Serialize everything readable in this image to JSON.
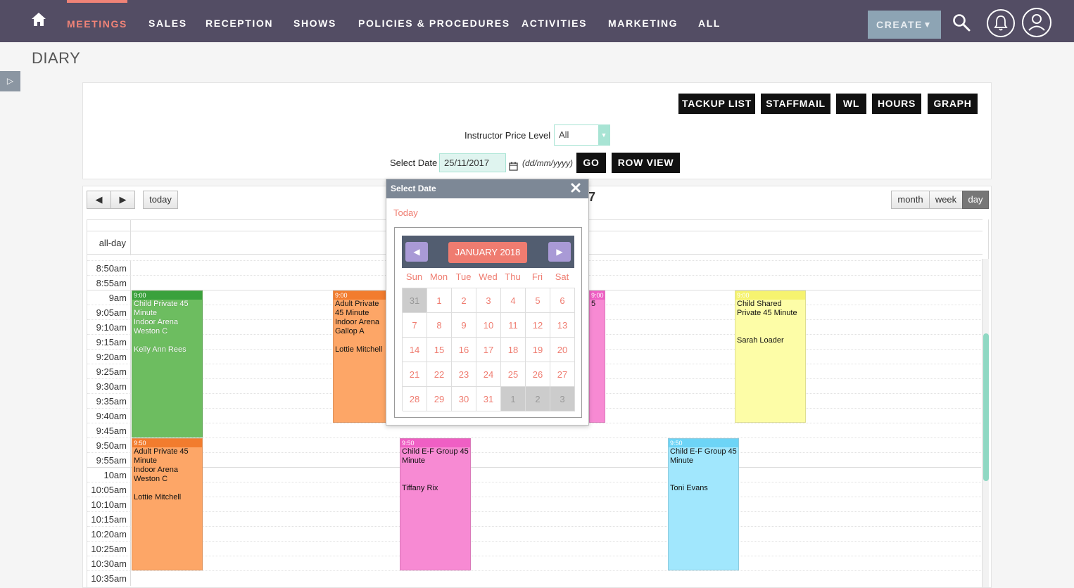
{
  "nav": {
    "items": [
      {
        "label": "MEETINGS",
        "active": true
      },
      {
        "label": "SALES"
      },
      {
        "label": "RECEPTION"
      },
      {
        "label": "SHOWS"
      },
      {
        "label": "POLICIES & PROCEDURES"
      },
      {
        "label": "ACTIVITIES"
      },
      {
        "label": "MARKETING"
      },
      {
        "label": "ALL"
      }
    ],
    "create_label": "CREATE",
    "create_caret": "▼",
    "icons": [
      "home-icon",
      "search-icon",
      "bell-icon",
      "user-icon"
    ]
  },
  "page": {
    "title": "DIARY",
    "sidebar_toggle": "▷"
  },
  "toolbar": {
    "buttons": [
      "TACKUP LIST",
      "STAFFMAIL",
      "WL",
      "HOURS",
      "GRAPH"
    ]
  },
  "filters": {
    "instructor_price_level_label": "Instructor Price Level",
    "instructor_price_level_value": "All",
    "select_date_label": "Select Date",
    "date_value": "25/11/2017",
    "date_format_hint": "(dd/mm/yyyy)",
    "go_label": "GO",
    "row_view_label": "ROW VIEW"
  },
  "calendar": {
    "prev": "◀",
    "next": "▶",
    "today": "today",
    "title_fragment": "7",
    "views": [
      "month",
      "week",
      "day"
    ],
    "active_view": "day",
    "allday_label": "all-day",
    "times": [
      "8:50am",
      "8:55am",
      "9am",
      "9:05am",
      "9:10am",
      "9:15am",
      "9:20am",
      "9:25am",
      "9:30am",
      "9:35am",
      "9:40am",
      "9:45am",
      "9:50am",
      "9:55am",
      "10am",
      "10:05am",
      "10:10am",
      "10:15am",
      "10:20am",
      "10:25am",
      "10:30am",
      "10:35am"
    ],
    "events": [
      {
        "time": "9:00",
        "title": "Child Private 45 Minute",
        "location": "Indoor Arena",
        "horse": "Weston C",
        "rider": "Kelly Ann Rees",
        "color": "green"
      },
      {
        "time": "9:00",
        "title": "Adult Private 45 Minute",
        "location": "Indoor Arena",
        "horse": "Gallop A",
        "rider": "Lottie Mitchell",
        "color": "orange"
      },
      {
        "time": "9:00",
        "title": "5",
        "color": "pink"
      },
      {
        "time": "9:00",
        "title": "Child Shared Private 45 Minute",
        "rider": "Sarah Loader",
        "color": "yellow"
      },
      {
        "time": "9:50",
        "title": "Adult Private 45 Minute",
        "location": "Indoor Arena",
        "horse": "Weston C",
        "rider": "Lottie Mitchell",
        "color": "orange"
      },
      {
        "time": "9:50",
        "title": "Child E-F Group 45 Minute",
        "rider": "Tiffany Rix",
        "color": "pink"
      },
      {
        "time": "9:50",
        "title": "Child E-F Group 45 Minute",
        "rider": "Toni Evans",
        "color": "cyan"
      }
    ]
  },
  "datepicker": {
    "header": "Select Date",
    "today_link": "Today",
    "month_label": "JANUARY 2018",
    "weekdays": [
      "Sun",
      "Mon",
      "Tue",
      "Wed",
      "Thu",
      "Fri",
      "Sat"
    ],
    "weeks": [
      [
        "31",
        "1",
        "2",
        "3",
        "4",
        "5",
        "6"
      ],
      [
        "7",
        "8",
        "9",
        "10",
        "11",
        "12",
        "13"
      ],
      [
        "14",
        "15",
        "16",
        "17",
        "18",
        "19",
        "20"
      ],
      [
        "21",
        "22",
        "23",
        "24",
        "25",
        "26",
        "27"
      ],
      [
        "28",
        "29",
        "30",
        "31",
        "1",
        "2",
        "3"
      ]
    ],
    "colors": {
      "accent": "#ef7c70",
      "nav": "#a99ad6",
      "bar": "#525d70"
    }
  },
  "colors": {
    "topbar": "#534d64",
    "active_nav": "#f08377",
    "create": "#8da4b4"
  }
}
